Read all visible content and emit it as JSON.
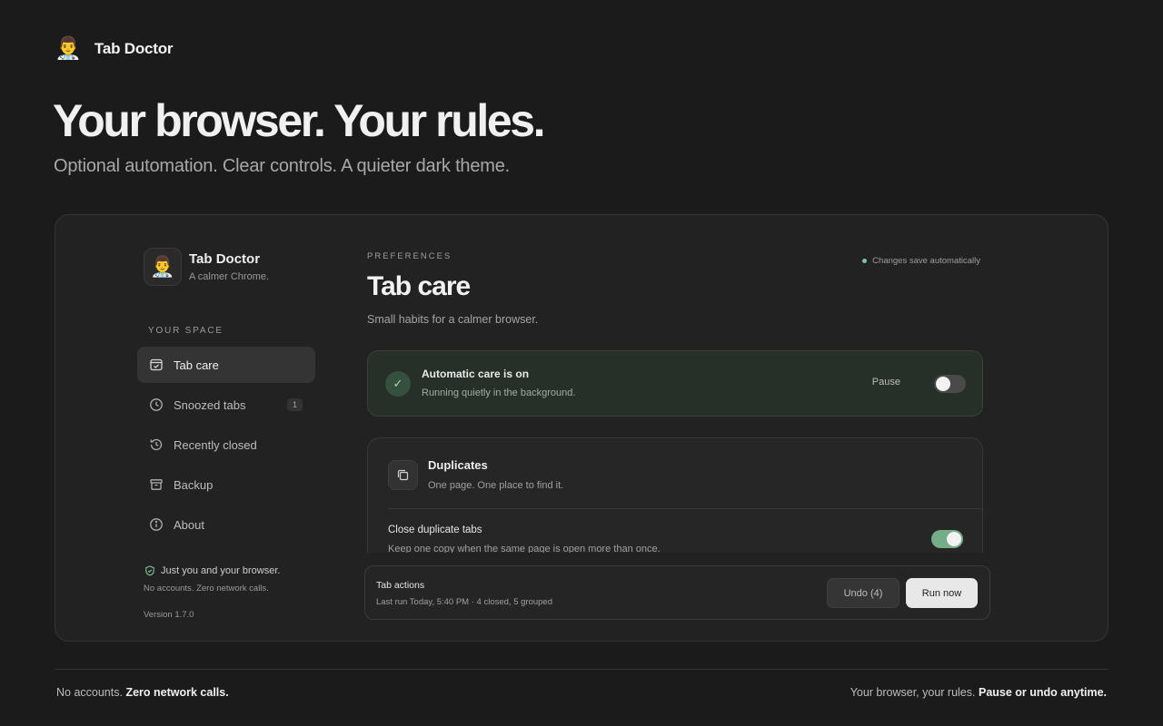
{
  "brand": {
    "emoji": "👨‍⚕️",
    "name": "Tab Doctor"
  },
  "hero": {
    "title": "Your browser. Your rules.",
    "subtitle": "Optional automation. Clear controls. A quieter dark theme."
  },
  "app": {
    "sidebar": {
      "logo_emoji": "👨‍⚕️",
      "title": "Tab Doctor",
      "tagline": "A calmer Chrome.",
      "section_label": "YOUR SPACE",
      "items": [
        {
          "label": "Tab care",
          "icon": "tab-care-icon",
          "active": true
        },
        {
          "label": "Snoozed tabs",
          "icon": "clock-icon",
          "badge": "1"
        },
        {
          "label": "Recently closed",
          "icon": "history-icon"
        },
        {
          "label": "Backup",
          "icon": "archive-icon"
        },
        {
          "label": "About",
          "icon": "info-icon"
        }
      ],
      "privacy_title": "Just you and your browser.",
      "privacy_desc": "No accounts. Zero network calls.",
      "version": "Version 1.7.0"
    },
    "main": {
      "eyebrow": "PREFERENCES",
      "saved_status": "Changes save automatically",
      "title": "Tab care",
      "subtitle": "Small habits for a calmer browser.",
      "status_card": {
        "title": "Automatic care is on",
        "desc": "Running quietly in the background.",
        "pause_label": "Pause",
        "paused": false
      },
      "duplicates": {
        "title": "Duplicates",
        "desc": "One page. One place to find it.",
        "option_title": "Close duplicate tabs",
        "option_desc": "Keep one copy when the same page is open more than once.",
        "enabled": true
      },
      "actions": {
        "title": "Tab actions",
        "meta": "Last run Today, 5:40 PM · 4 closed, 5 grouped",
        "undo_label": "Undo (4)",
        "run_label": "Run now"
      }
    }
  },
  "footer": {
    "left_plain": "No accounts.",
    "left_bold": "Zero network calls.",
    "right_plain": "Your browser, your rules.",
    "right_bold": "Pause or undo anytime."
  },
  "colors": {
    "accent_green": "#74ad88",
    "status_bg": "#263028",
    "background": "#1b1b1b"
  }
}
